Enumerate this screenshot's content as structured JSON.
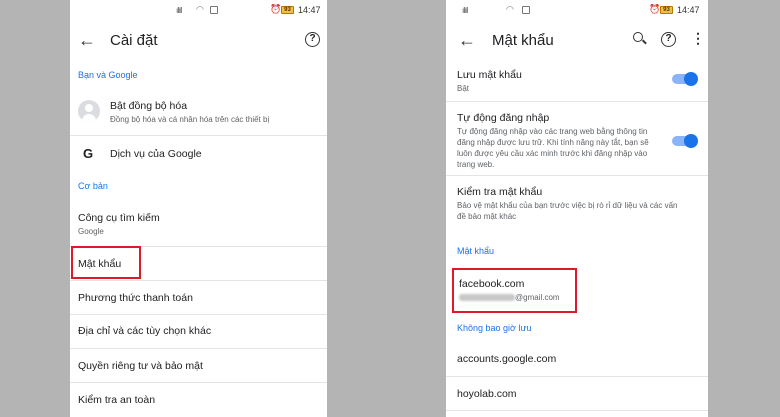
{
  "left_screen": {
    "status": {
      "time": "14:47",
      "battery": "93"
    },
    "title": "Cài đặt",
    "section_google": "Bạn và Google",
    "sync": {
      "label": "Bật đồng bộ hóa",
      "sub": "Đồng bộ hóa và cá nhân hóa trên các thiết bị"
    },
    "google_services": "Dịch vụ của Google",
    "section_basic": "Cơ bản",
    "search_engine": {
      "label": "Công cụ tìm kiếm",
      "sub": "Google"
    },
    "passwords": "Mật khẩu",
    "payment": "Phương thức thanh toán",
    "addresses": "Địa chỉ và các tùy chọn khác",
    "privacy": "Quyền riêng tư và bảo mật",
    "safety": "Kiểm tra an toàn"
  },
  "right_screen": {
    "status": {
      "time": "14:47",
      "battery": "93"
    },
    "title": "Mật khẩu",
    "save_passwords": {
      "label": "Lưu mật khẩu",
      "sub": "Bật",
      "enabled": true
    },
    "auto_signin": {
      "label": "Tự động đăng nhập",
      "sub": "Tự động đăng nhập vào các trang web bằng thông tin đăng nhập được lưu trữ. Khi tính năng này tắt, bạn sẽ luôn được yêu cầu xác minh trước khi đăng nhập vào trang web.",
      "enabled": true
    },
    "check_passwords": {
      "label": "Kiểm tra mật khẩu",
      "sub": "Bảo vệ mật khẩu của bạn trước việc bị rò rỉ dữ liệu và các vấn đề bảo mật khác"
    },
    "section_passwords": "Mật khẩu",
    "saved_site": {
      "site": "facebook.com",
      "email_suffix": "@gmail.com"
    },
    "section_never": "Không bao giờ lưu",
    "never_sites": [
      "accounts.google.com",
      "hoyolab.com"
    ]
  },
  "colors": {
    "accent": "#1a73e8",
    "highlight": "#e0192a",
    "background": "#b4b4b4"
  }
}
